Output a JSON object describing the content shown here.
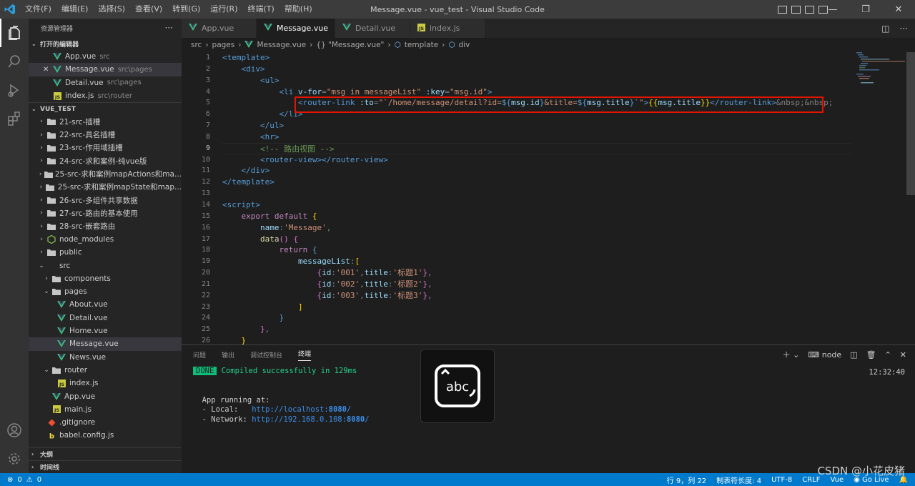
{
  "menu": [
    "文件(F)",
    "编辑(E)",
    "选择(S)",
    "查看(V)",
    "转到(G)",
    "运行(R)",
    "终端(T)",
    "帮助(H)"
  ],
  "window_title": "Message.vue - vue_test - Visual Studio Code",
  "sidebar": {
    "title": "资源管理器",
    "open_editors_label": "打开的编辑器",
    "open_editors": [
      {
        "name": "App.vue",
        "desc": "src",
        "icon": "vue"
      },
      {
        "name": "Message.vue",
        "desc": "src\\pages",
        "icon": "vue",
        "active": true
      },
      {
        "name": "Detail.vue",
        "desc": "src\\pages",
        "icon": "vue"
      },
      {
        "name": "index.js",
        "desc": "src\\router",
        "icon": "js"
      }
    ],
    "project_label": "VUE_TEST",
    "tree": [
      {
        "name": "21-src-插槽",
        "icon": "folder",
        "depth": 0,
        "tw": "›"
      },
      {
        "name": "22-src-具名插槽",
        "icon": "folder",
        "depth": 0,
        "tw": "›"
      },
      {
        "name": "23-src-作用域插槽",
        "icon": "folder",
        "depth": 0,
        "tw": "›"
      },
      {
        "name": "24-src-求和案例-纯vue版",
        "icon": "folder",
        "depth": 0,
        "tw": "›"
      },
      {
        "name": "25-src-求和案例mapActions和ma...",
        "icon": "folder",
        "depth": 0,
        "tw": "›"
      },
      {
        "name": "25-src-求和案例mapState和map...",
        "icon": "folder",
        "depth": 0,
        "tw": "›"
      },
      {
        "name": "26-src-多组件共享数据",
        "icon": "folder",
        "depth": 0,
        "tw": "›"
      },
      {
        "name": "27-src-路由的基本使用",
        "icon": "folder",
        "depth": 0,
        "tw": "›"
      },
      {
        "name": "28-src-嵌套路由",
        "icon": "folder",
        "depth": 0,
        "tw": "›"
      },
      {
        "name": "node_modules",
        "icon": "node",
        "depth": 0,
        "tw": "›"
      },
      {
        "name": "public",
        "icon": "folder",
        "depth": 0,
        "tw": "›"
      },
      {
        "name": "src",
        "icon": "none",
        "depth": 0,
        "tw": "⌄"
      },
      {
        "name": "components",
        "icon": "folder",
        "depth": 1,
        "tw": "›"
      },
      {
        "name": "pages",
        "icon": "folder",
        "depth": 1,
        "tw": "⌄"
      },
      {
        "name": "About.vue",
        "icon": "vue",
        "depth": 2,
        "tw": ""
      },
      {
        "name": "Detail.vue",
        "icon": "vue",
        "depth": 2,
        "tw": ""
      },
      {
        "name": "Home.vue",
        "icon": "vue",
        "depth": 2,
        "tw": ""
      },
      {
        "name": "Message.vue",
        "icon": "vue",
        "depth": 2,
        "tw": "",
        "sel": true
      },
      {
        "name": "News.vue",
        "icon": "vue",
        "depth": 2,
        "tw": ""
      },
      {
        "name": "router",
        "icon": "folder",
        "depth": 1,
        "tw": "⌄"
      },
      {
        "name": "index.js",
        "icon": "js",
        "depth": 2,
        "tw": ""
      },
      {
        "name": "App.vue",
        "icon": "vue",
        "depth": 1,
        "tw": ""
      },
      {
        "name": "main.js",
        "icon": "js",
        "depth": 1,
        "tw": ""
      },
      {
        "name": ".gitignore",
        "icon": "git",
        "depth": 0,
        "tw": ""
      },
      {
        "name": "babel.config.js",
        "icon": "babel",
        "depth": 0,
        "tw": ""
      }
    ],
    "outline_label": "大纲",
    "timeline_label": "时间线"
  },
  "tabs": [
    {
      "name": "App.vue",
      "icon": "vue"
    },
    {
      "name": "Message.vue",
      "icon": "vue",
      "active": true
    },
    {
      "name": "Detail.vue",
      "icon": "vue"
    },
    {
      "name": "index.js",
      "icon": "js"
    }
  ],
  "breadcrumb": [
    "src",
    "pages",
    "Message.vue",
    "{} \"Message.vue\"",
    "template",
    "div"
  ],
  "editor": {
    "current_line": 9,
    "lines": [
      [
        [
          "tg",
          "<template>"
        ]
      ],
      [
        [
          "tg",
          "    <div>"
        ]
      ],
      [
        [
          "tg",
          "        <ul>"
        ]
      ],
      [
        [
          "tg",
          "            <li "
        ],
        [
          "at",
          "v-for"
        ],
        [
          "pu",
          "="
        ],
        [
          "st",
          "\"msg in messageList\""
        ],
        [
          "pu",
          " "
        ],
        [
          "at",
          ":key"
        ],
        [
          "pu",
          "="
        ],
        [
          "st",
          "\"msg.id\""
        ],
        [
          "tg",
          ">"
        ]
      ],
      [
        [
          "pu",
          "                "
        ],
        [
          "tg",
          "<router-link "
        ],
        [
          "at",
          ":to"
        ],
        [
          "pu",
          "="
        ],
        [
          "st",
          "\"`/home/message/detail?id="
        ],
        [
          "sy",
          "${"
        ],
        [
          "at",
          "msg.id"
        ],
        [
          "sy",
          "}"
        ],
        [
          "st",
          "&title="
        ],
        [
          "sy",
          "${"
        ],
        [
          "at",
          "msg.title"
        ],
        [
          "sy",
          "}"
        ],
        [
          "st",
          "`\""
        ],
        [
          "tg",
          ">"
        ],
        [
          "br",
          "{{"
        ],
        [
          "at",
          "msg.title"
        ],
        [
          "br",
          "}}"
        ],
        [
          "tg",
          "</router-link>"
        ],
        [
          "pu",
          "&nbsp;&nbsp;"
        ]
      ],
      [
        [
          "tg",
          "            </li>"
        ]
      ],
      [
        [
          "tg",
          "        </ul>"
        ]
      ],
      [
        [
          "tg",
          "        <hr>"
        ]
      ],
      [
        [
          "cm",
          "        <!-- 路由视图 -->"
        ]
      ],
      [
        [
          "tg",
          "        <router-view></router-view>"
        ]
      ],
      [
        [
          "tg",
          "    </div>"
        ]
      ],
      [
        [
          "tg",
          "</template>"
        ]
      ],
      [
        [
          "pu",
          ""
        ]
      ],
      [
        [
          "tg",
          "<script>"
        ]
      ],
      [
        [
          "kw",
          "    export default "
        ],
        [
          "br",
          "{"
        ]
      ],
      [
        [
          "at",
          "        name"
        ],
        [
          "pu",
          ":"
        ],
        [
          "st",
          "'Message'"
        ],
        [
          "pu",
          ","
        ]
      ],
      [
        [
          "fn",
          "        data"
        ],
        [
          "br2",
          "()"
        ],
        [
          "pu",
          " "
        ],
        [
          "br2",
          "{"
        ]
      ],
      [
        [
          "kw",
          "            return "
        ],
        [
          "sy",
          "{"
        ]
      ],
      [
        [
          "at",
          "                messageList"
        ],
        [
          "pu",
          ":"
        ],
        [
          "br",
          "["
        ]
      ],
      [
        [
          "pu",
          "                    "
        ],
        [
          "br2",
          "{"
        ],
        [
          "at",
          "id"
        ],
        [
          "pu",
          ":"
        ],
        [
          "st",
          "'001'"
        ],
        [
          "pu",
          ","
        ],
        [
          "at",
          "title"
        ],
        [
          "pu",
          ":"
        ],
        [
          "st",
          "'标题1'"
        ],
        [
          "br2",
          "}"
        ],
        [
          "pu",
          ","
        ]
      ],
      [
        [
          "pu",
          "                    "
        ],
        [
          "br2",
          "{"
        ],
        [
          "at",
          "id"
        ],
        [
          "pu",
          ":"
        ],
        [
          "st",
          "'002'"
        ],
        [
          "pu",
          ","
        ],
        [
          "at",
          "title"
        ],
        [
          "pu",
          ":"
        ],
        [
          "st",
          "'标题2'"
        ],
        [
          "br2",
          "}"
        ],
        [
          "pu",
          ","
        ]
      ],
      [
        [
          "pu",
          "                    "
        ],
        [
          "br2",
          "{"
        ],
        [
          "at",
          "id"
        ],
        [
          "pu",
          ":"
        ],
        [
          "st",
          "'003'"
        ],
        [
          "pu",
          ","
        ],
        [
          "at",
          "title"
        ],
        [
          "pu",
          ":"
        ],
        [
          "st",
          "'标题3'"
        ],
        [
          "br2",
          "}"
        ],
        [
          "pu",
          ","
        ]
      ],
      [
        [
          "br",
          "                ]"
        ]
      ],
      [
        [
          "sy",
          "            }"
        ]
      ],
      [
        [
          "br2",
          "        }"
        ],
        [
          "pu",
          ","
        ]
      ],
      [
        [
          "br",
          "    }"
        ]
      ]
    ]
  },
  "panel": {
    "tabs": [
      "问题",
      "输出",
      "调试控制台",
      "终端"
    ],
    "active_tab": "终端",
    "terminal_name": "node",
    "time": "12:32:40",
    "done_badge": "DONE",
    "compiled": "Compiled successfully in 129ms",
    "app_running": "App running at:",
    "local_label": "- Local:   ",
    "local_url_prefix": "http://localhost:",
    "local_port": "8080",
    "network_label": "- Network: ",
    "network_url_prefix": "http://192.168.0.108:",
    "network_port": "8080",
    "network_url_suffix": "/",
    "local_url_suffix": "/"
  },
  "overlay": {
    "text": "abc"
  },
  "status": {
    "errors": "0",
    "warnings": "0",
    "position": "行 9，列 22",
    "tab_size": "制表符长度: 4",
    "encoding": "UTF-8",
    "eol": "CRLF",
    "language": "Vue",
    "golive": "Go Live"
  },
  "watermark": "CSDN @小花皮猪"
}
